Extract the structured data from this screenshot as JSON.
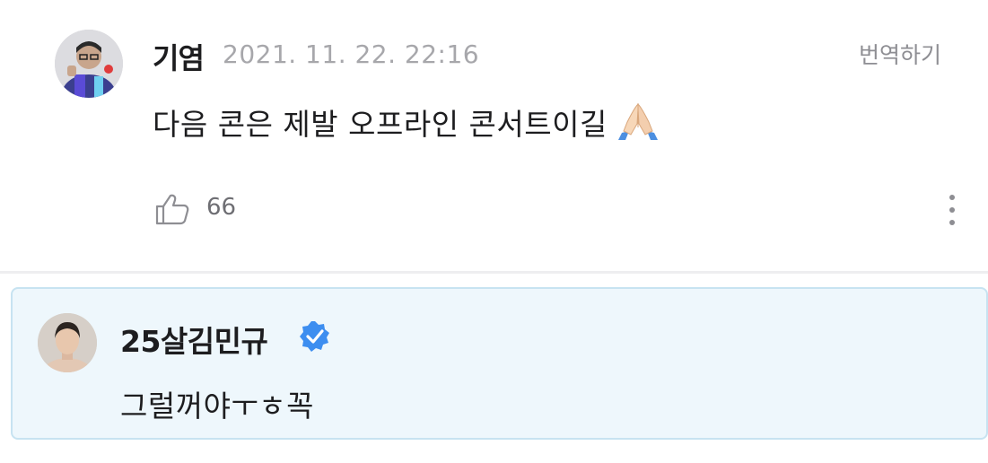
{
  "comment": {
    "author": "기염",
    "timestamp": "2021. 11. 22. 22:16",
    "translate_label": "번역하기",
    "text": "다음 콘은 제발 오프라인 콘서트이길",
    "emoji": "folded-hands-emoji",
    "like_count": "66"
  },
  "reply": {
    "author": "25살김민규",
    "verified": true,
    "text": "그럴꺼야ㅜㅎ꼭"
  },
  "colors": {
    "reply_background": "#eef7fc",
    "reply_border": "#c7e3f1",
    "verified_badge": "#3d8ef0",
    "timestamp": "#a7a7ab"
  }
}
